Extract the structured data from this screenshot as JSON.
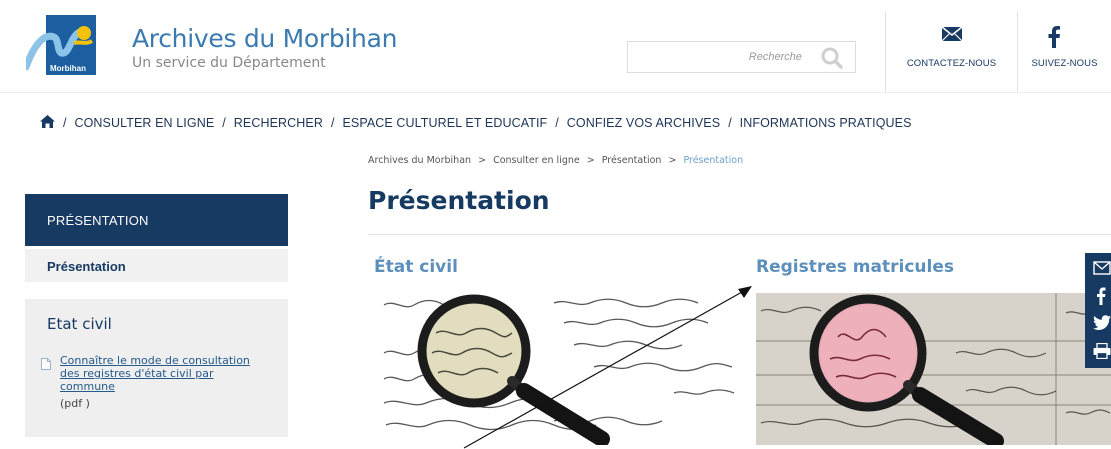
{
  "header": {
    "logo_text": "Morbihan",
    "site_title": "Archives du Morbihan",
    "site_subtitle": "Un service du Département",
    "search_placeholder": "Recherche",
    "contact_label": "CONTACTEZ-NOUS",
    "follow_label": "SUIVEZ-NOUS"
  },
  "nav": {
    "home_icon": "home-icon",
    "items": [
      {
        "label": "CONSULTER EN LIGNE"
      },
      {
        "label": "RECHERCHER"
      },
      {
        "label": "ESPACE CULTUREL ET EDUCATIF"
      },
      {
        "label": "CONFIEZ VOS ARCHIVES"
      },
      {
        "label": "INFORMATIONS PRATIQUES"
      }
    ],
    "separator": "/"
  },
  "breadcrumb": {
    "items": [
      "Archives du Morbihan",
      "Consulter en ligne",
      "Présentation"
    ],
    "current": "Présentation",
    "separator": ">"
  },
  "page_title": "Présentation",
  "sidebar": {
    "heading": "PRÉSENTATION",
    "item": "Présentation",
    "box": {
      "title": "Etat civil",
      "link": "Connaître le mode de consultation des registres d'état civil par commune",
      "meta": "(pdf )"
    }
  },
  "cards": [
    {
      "title": "État civil"
    },
    {
      "title": "Registres matricules"
    }
  ],
  "share": {
    "icons": [
      "mail-icon",
      "facebook-icon",
      "twitter-icon",
      "print-icon"
    ]
  },
  "colors": {
    "navy": "#173a63",
    "link_blue": "#5d8fbb",
    "title_blue": "#3a7ab0"
  }
}
